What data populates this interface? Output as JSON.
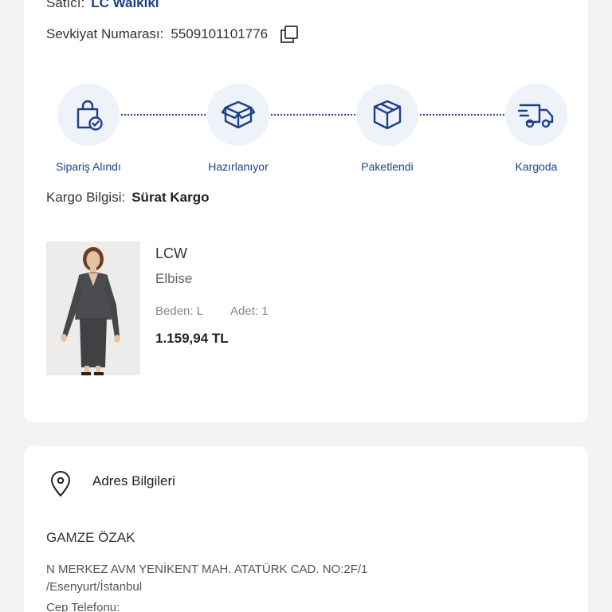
{
  "order": {
    "seller_label": "Satıcı:",
    "seller_value": "LC Waikiki",
    "shipment_label": "Sevkiyat Numarası:",
    "shipment_number": "5509101101776",
    "cargo_label": "Kargo Bilgisi:",
    "cargo_value": "Sürat Kargo"
  },
  "steps": [
    {
      "label": "Sipariş Alındı",
      "icon": "shopping-bag-check-icon"
    },
    {
      "label": "Hazırlanıyor",
      "icon": "open-box-icon"
    },
    {
      "label": "Paketlendi",
      "icon": "package-icon"
    },
    {
      "label": "Kargoda",
      "icon": "delivery-truck-icon"
    }
  ],
  "product": {
    "brand": "LCW",
    "name": "Elbise",
    "size_label": "Beden:",
    "size_value": "L",
    "qty_label": "Adet:",
    "qty_value": "1",
    "price": "1.159,94 TL"
  },
  "address": {
    "title": "Adres Bilgileri",
    "name": "GAMZE ÖZAK",
    "line1": "N MERKEZ AVM YENİKENT MAH. ATATÜRK CAD. NO:2F/1",
    "line2": "/Esenyurt/İstanbul",
    "phone_label": "Cep Telefonu:"
  },
  "colors": {
    "accent": "#1e3f8a",
    "step_bg": "#eef3fa",
    "page_bg": "#f3f3f3"
  }
}
